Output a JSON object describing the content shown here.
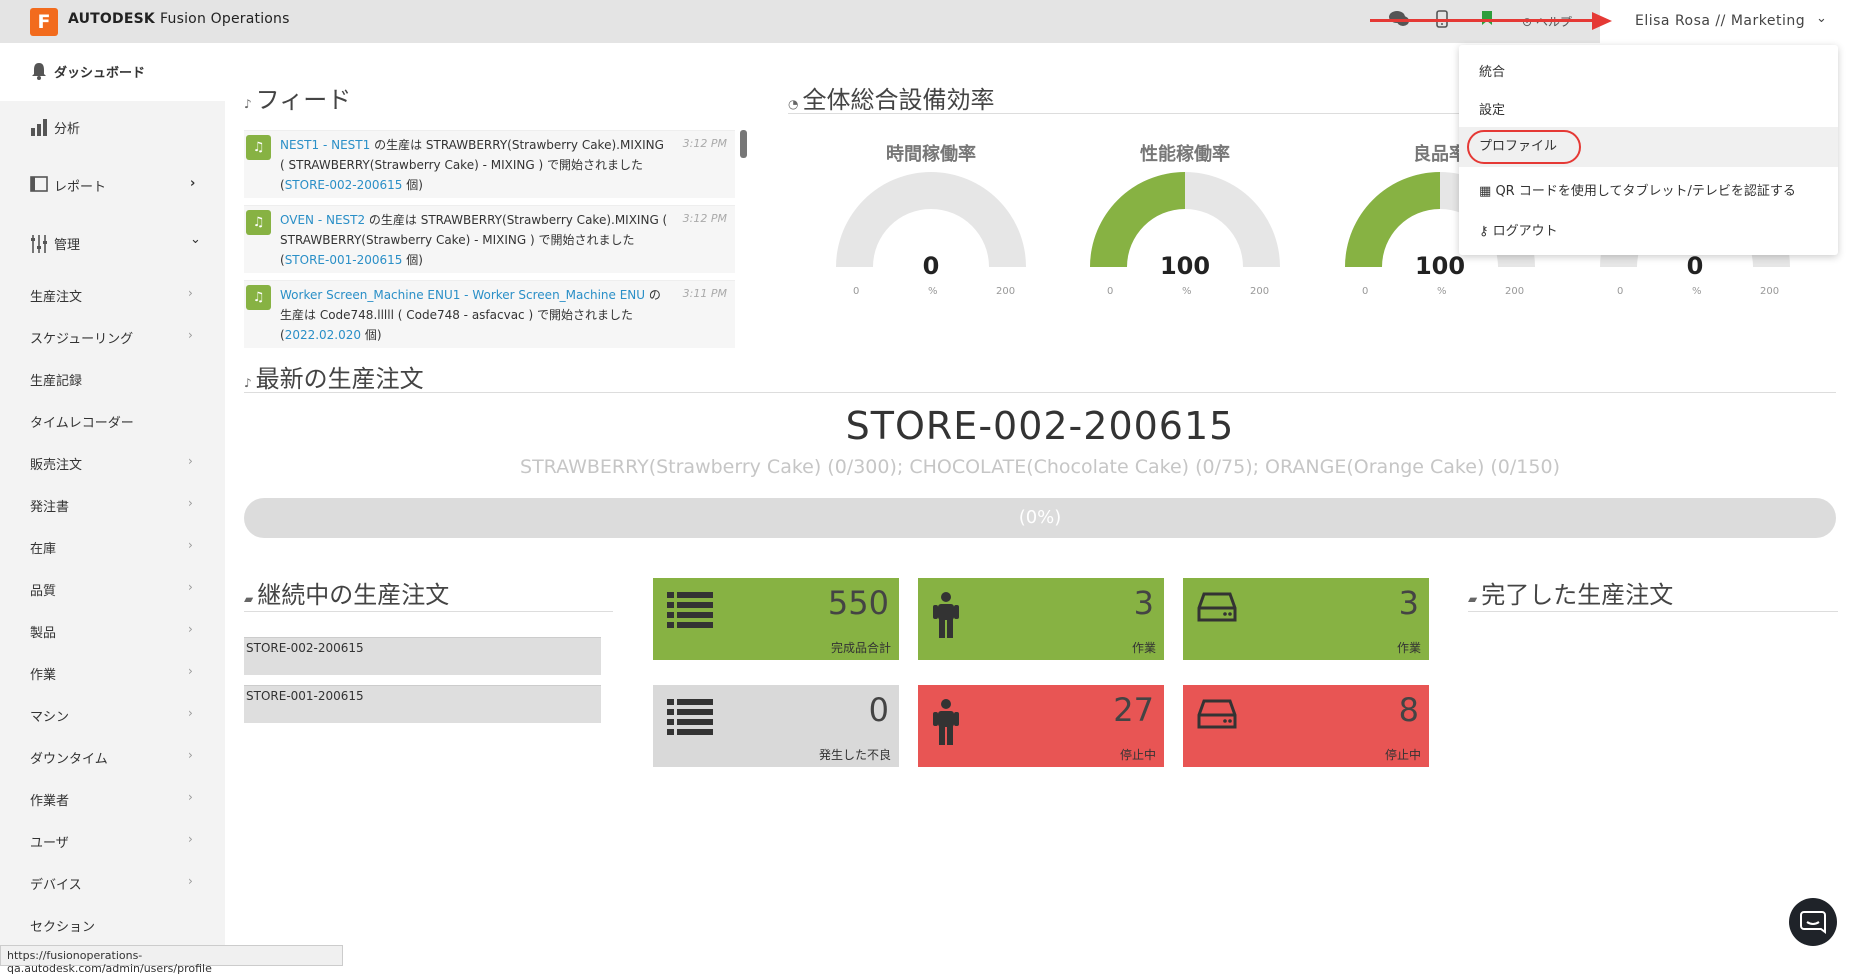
{
  "topbar": {
    "logo_letter": "F",
    "brand_bold": "AUTODESK",
    "brand_light": "Fusion Operations",
    "help_label": "ヘルプ",
    "user_label": "Elisa Rosa // Marketing"
  },
  "user_dropdown": {
    "items": [
      "統合",
      "設定",
      "プロファイル",
      "QR コードを使用してタブレット/テレビを認証する",
      "ログアウト"
    ]
  },
  "sidebar": {
    "dashboard": "ダッシュボード",
    "analysis": "分析",
    "reports": "レポート",
    "admin": "管理",
    "sub_items": [
      "生産注文",
      "スケジューリング",
      "生産記録",
      "タイムレコーダー",
      "販売注文",
      "発注書",
      "在庫",
      "品質",
      "製品",
      "作業",
      "マシン",
      "ダウンタイム",
      "作業者",
      "ユーザ",
      "デバイス",
      "セクション"
    ]
  },
  "feed": {
    "title": "フィード",
    "items": [
      {
        "source": "NEST1 - NEST1",
        "text_a": " の生産は STRAWBERRY(Strawberry Cake).MIXING ( STRAWBERRY(Strawberry Cake) - MIXING ) で開始されました(",
        "link": "STORE-002-200615",
        "text_b": " 個)",
        "time": "3:12 PM"
      },
      {
        "source": "OVEN - NEST2",
        "text_a": " の生産は STRAWBERRY(Strawberry Cake).MIXING ( STRAWBERRY(Strawberry Cake) - MIXING ) で開始されました(",
        "link": "STORE-001-200615",
        "text_b": " 個)",
        "time": "3:12 PM"
      },
      {
        "source": "Worker Screen_Machine ENU1 - Worker Screen_Machine ENU",
        "text_a": " の生産は Code748.lllll ( Code748 - asfacvac ) で開始されました(",
        "link": "2022.02.020",
        "text_b": " 個)",
        "time": "3:11 PM"
      }
    ]
  },
  "oee": {
    "title": "全体総合設備効率",
    "gauges": [
      {
        "title": "時間稼働率",
        "value": "0",
        "fraction": 0,
        "min": "0",
        "max": "200",
        "unit": "%"
      },
      {
        "title": "性能稼働率",
        "value": "100",
        "fraction": 0.5,
        "min": "0",
        "max": "200",
        "unit": "%"
      },
      {
        "title": "良品率",
        "value": "100",
        "fraction": 0.5,
        "min": "0",
        "max": "200",
        "unit": "%"
      },
      {
        "title": "",
        "value": "0",
        "fraction": 0,
        "min": "0",
        "max": "200",
        "unit": "%"
      }
    ]
  },
  "latest": {
    "title": "最新の生産注文",
    "order_id": "STORE-002-200615",
    "products": "STRAWBERRY(Strawberry Cake) (0/300); CHOCOLATE(Chocolate Cake) (0/75); ORANGE(Orange Cake) (0/150)",
    "progress_label": "(0%)",
    "progress_fraction": 0
  },
  "ongoing": {
    "title": "継続中の生産注文",
    "orders": [
      "STORE-002-200615",
      "STORE-001-200615"
    ]
  },
  "completed": {
    "title": "完了した生産注文"
  },
  "tiles": [
    {
      "value": "550",
      "label": "完成品合計",
      "color": "#87b243",
      "icon": "list-icon"
    },
    {
      "value": "3",
      "label": "作業",
      "color": "#87b243",
      "icon": "person-icon"
    },
    {
      "value": "3",
      "label": "作業",
      "color": "#87b243",
      "icon": "drive-icon"
    },
    {
      "value": "0",
      "label": "発生した不良",
      "color": "#d9d9d9",
      "icon": "list-icon"
    },
    {
      "value": "27",
      "label": "停止中",
      "color": "#e85554",
      "icon": "person-icon"
    },
    {
      "value": "8",
      "label": "停止中",
      "color": "#e85554",
      "icon": "drive-icon"
    }
  ],
  "status_url": "https://fusionoperations-qa.autodesk.com/admin/users/profile"
}
